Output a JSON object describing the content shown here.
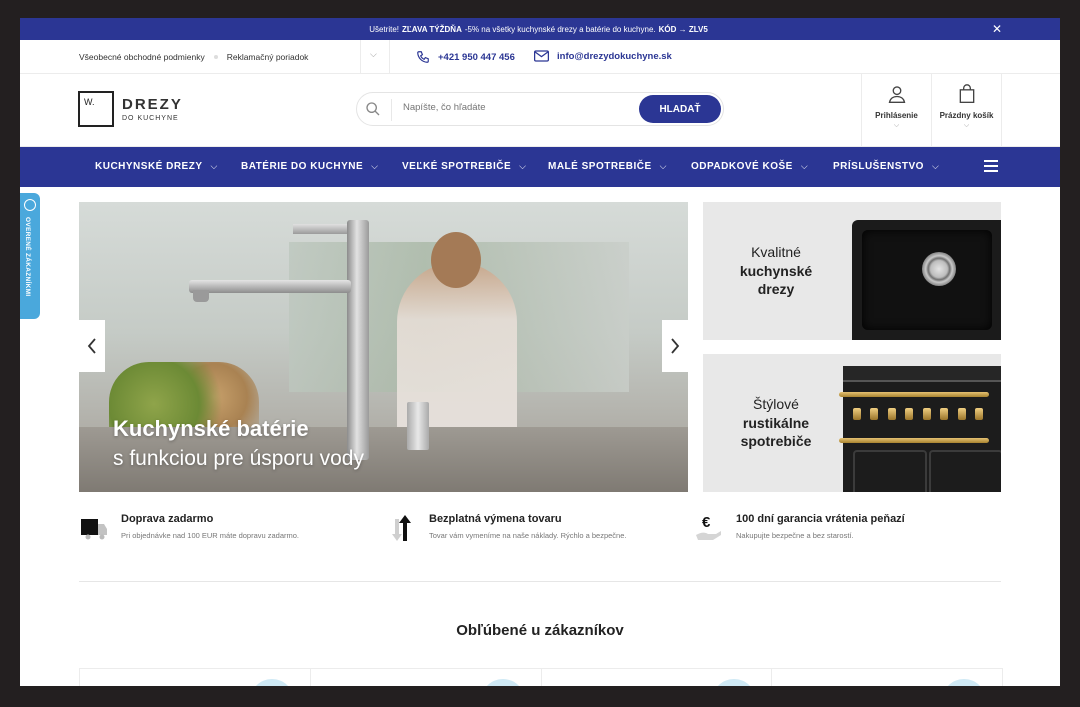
{
  "promo": {
    "prefix": "Ušetrite!",
    "highlight": "ZĽAVA TÝŽDŇA",
    "text": "-5% na všetky kuchynské drezy a batérie do kuchyne.",
    "code_label": "KÓD → ZLV5",
    "close": "✕"
  },
  "topbar": {
    "links": [
      "Všeobecné obchodné podmienky",
      "Reklamačný poriadok"
    ],
    "phone": "+421 950 447 456",
    "email": "info@drezydokuchyne.sk"
  },
  "logo": {
    "mark": "W.",
    "title": "DREZY",
    "subtitle": "DO KUCHYNE"
  },
  "search": {
    "placeholder": "Napíšte, čo hľadáte",
    "button": "HLADAŤ"
  },
  "header_actions": {
    "login": "Prihlásenie",
    "cart": "Prázdny košík"
  },
  "nav": {
    "items": [
      "KUCHYNSKÉ DREZY",
      "BATÉRIE DO KUCHYNE",
      "VEĽKÉ SPOTREBIČE",
      "MALÉ SPOTREBIČE",
      "ODPADKOVÉ KOŠE",
      "PRÍSLUŠENSTVO"
    ]
  },
  "side_tab": {
    "label": "OVERENÉ ZÁKAZNÍKMI"
  },
  "hero": {
    "title": "Kuchynské batérie",
    "subtitle": "s funkciou pre úsporu vody"
  },
  "banners": [
    {
      "line1": "Kvalitné",
      "line2": "kuchynské",
      "line3": "drezy"
    },
    {
      "line1": "Štýlové",
      "line2": "rustikálne",
      "line3": "spotrebiče"
    }
  ],
  "benefits": [
    {
      "title": "Doprava zadarmo",
      "desc": "Pri objednávke nad 100 EUR máte dopravu zadarmo."
    },
    {
      "title": "Bezplatná výmena tovaru",
      "desc": "Tovar vám vymeníme na naše náklady. Rýchlo a bezpečne."
    },
    {
      "title": "100 dní garancia vrátenia peňazí",
      "desc": "Nakupujte bezpečne a bez starostí."
    }
  ],
  "popular": {
    "title": "Obľúbené u zákazníkov"
  },
  "colors": {
    "brand": "#2b3694",
    "accent": "#4aa8dc"
  }
}
